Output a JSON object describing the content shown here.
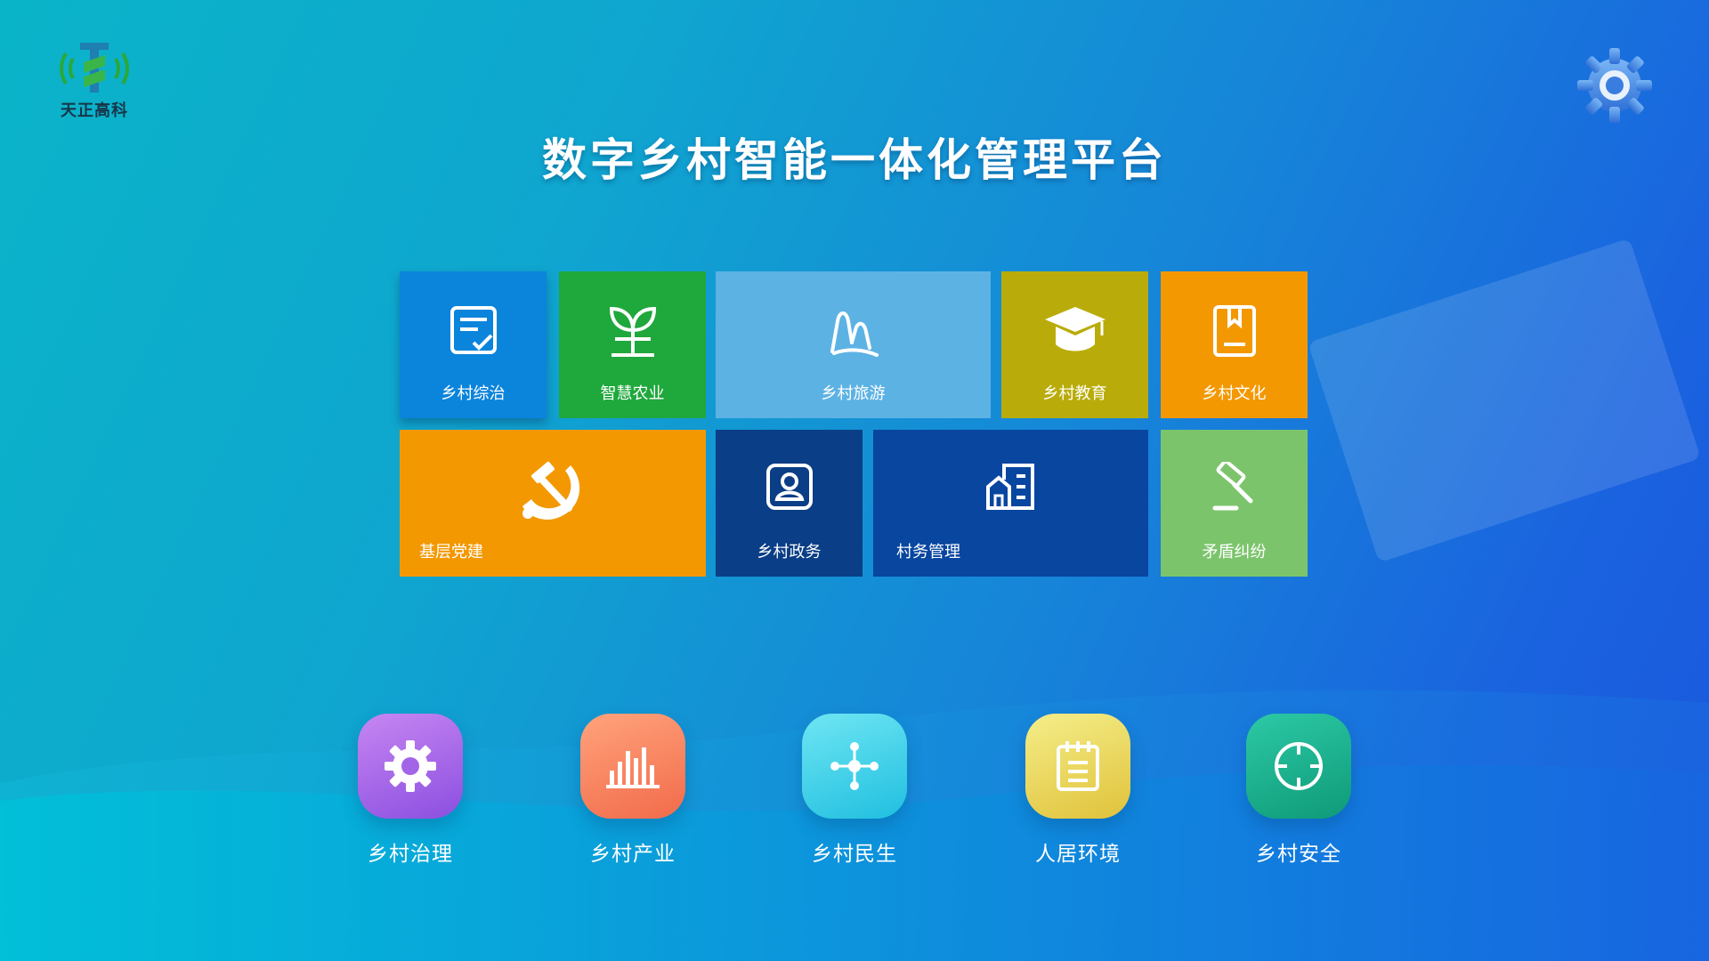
{
  "brand": {
    "logo_text": "天正高科"
  },
  "header": {
    "title": "数字乡村智能一体化管理平台"
  },
  "tiles": [
    {
      "label": "乡村综治",
      "icon": "document-check-icon",
      "color": "#0b84dc"
    },
    {
      "label": "智慧农业",
      "icon": "sprout-icon",
      "color": "#1fa83c"
    },
    {
      "label": "乡村旅游",
      "icon": "mountain-icon",
      "color": "#5db2e4"
    },
    {
      "label": "乡村教育",
      "icon": "graduation-cap-icon",
      "color": "#b9ac0a"
    },
    {
      "label": "乡村文化",
      "icon": "book-icon",
      "color": "#f39800"
    },
    {
      "label": "基层党建",
      "icon": "hammer-sickle-icon",
      "color": "#f39800"
    },
    {
      "label": "乡村政务",
      "icon": "person-badge-icon",
      "color": "#0a3e86"
    },
    {
      "label": "村务管理",
      "icon": "building-icon",
      "color": "#0846a0"
    },
    {
      "label": "矛盾纠纷",
      "icon": "gavel-icon",
      "color": "#7cc46c"
    }
  ],
  "bottom_nav": [
    {
      "label": "乡村治理",
      "icon": "gear-icon"
    },
    {
      "label": "乡村产业",
      "icon": "bar-chart-icon"
    },
    {
      "label": "乡村民生",
      "icon": "network-icon"
    },
    {
      "label": "人居环境",
      "icon": "notepad-icon"
    },
    {
      "label": "乡村安全",
      "icon": "target-icon"
    }
  ],
  "colors": {
    "background_start": "#0ab4c8",
    "background_end": "#1b57dd",
    "settings_gear": "#4a8fe8"
  }
}
